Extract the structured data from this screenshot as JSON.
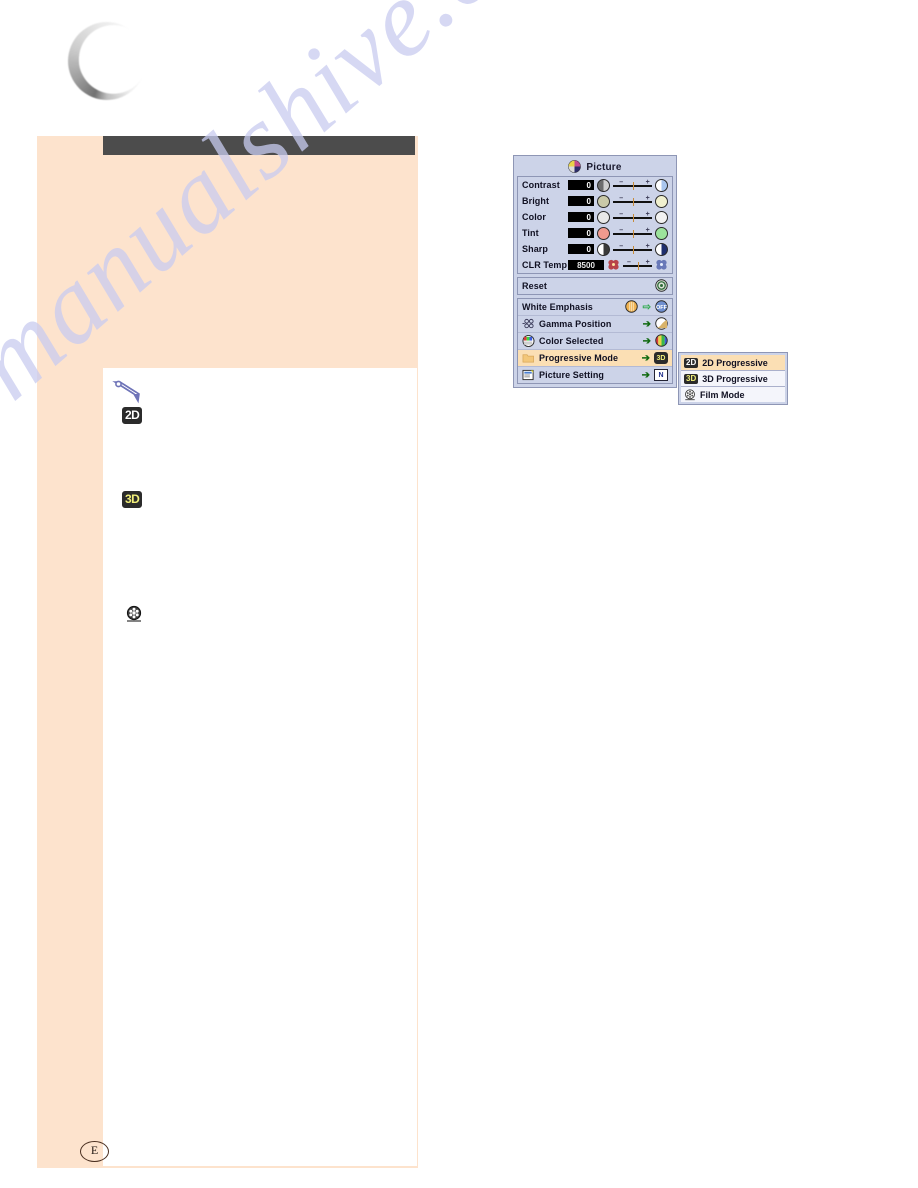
{
  "page": {
    "language_mark": "E",
    "watermark": "manualshive.com"
  },
  "note_block": {
    "icon": "pencil-note-icon",
    "badges": [
      {
        "id": "2d-badge",
        "label": "2D"
      },
      {
        "id": "3d-badge",
        "label": "3D"
      },
      {
        "id": "film-badge",
        "label": "film-reel-icon"
      }
    ]
  },
  "osd": {
    "title": "Picture",
    "title_icon": "picture-icon",
    "sliders": [
      {
        "label": "Contrast",
        "value": "0",
        "left_icon": "contrast-icon",
        "right_icon": "contrast-icon"
      },
      {
        "label": "Bright",
        "value": "0",
        "left_icon": "brightness-icon",
        "right_icon": "brightness-icon"
      },
      {
        "label": "Color",
        "value": "0",
        "left_icon": "color-low-icon",
        "right_icon": "color-high-icon"
      },
      {
        "label": "Tint",
        "value": "0",
        "left_icon": "tint-red-icon",
        "right_icon": "tint-green-icon"
      },
      {
        "label": "Sharp",
        "value": "0",
        "left_icon": "sharpness-icon",
        "right_icon": "sharpness-icon"
      },
      {
        "label": "CLR Temp",
        "value": "8500",
        "left_icon": "clr-temp-low-icon",
        "right_icon": "clr-temp-high-icon"
      }
    ],
    "slider_ticks": {
      "minus": "–",
      "plus": "+"
    },
    "reset": {
      "label": "Reset",
      "icon": "reset-icon"
    },
    "menu_items": [
      {
        "label": "White Emphasis",
        "icon": "white-emphasis-icon",
        "arrow": "⇨",
        "value_icon": "OFF",
        "selected": false
      },
      {
        "label": "Gamma Position",
        "icon": "gamma-icon",
        "arrow": "➔",
        "value_icon": "gamma-curve-icon",
        "selected": false
      },
      {
        "label": "Color Selected",
        "icon": "color-selected-icon",
        "arrow": "➔",
        "value_icon": "color-bars-icon",
        "selected": false
      },
      {
        "label": "Progressive Mode",
        "icon": "progressive-icon",
        "arrow": "➔",
        "value_icon": "3D",
        "selected": true
      },
      {
        "label": "Picture Setting",
        "icon": "picture-setting-icon",
        "arrow": "➔",
        "value_icon": "N",
        "selected": false
      }
    ]
  },
  "submenu": {
    "items": [
      {
        "badge": "2D",
        "label": "2D Progressive",
        "selected": true
      },
      {
        "badge": "3D",
        "label": "3D Progressive",
        "selected": false
      },
      {
        "badge": "film-reel-icon",
        "label": "Film Mode",
        "selected": false
      }
    ]
  },
  "colors": {
    "peach": "#fde3cd",
    "dark_bar": "#4c4c4c",
    "osd_bg": "#ccd3e8",
    "highlight": "#fbdfb4",
    "watermark": "#c9ccf0"
  }
}
